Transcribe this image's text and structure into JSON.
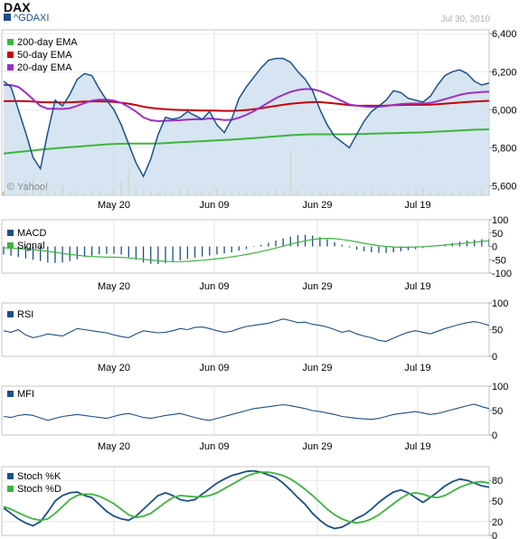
{
  "header": {
    "title": "DAX",
    "symbol": "^GDAXI",
    "date": "Jul 30, 2010"
  },
  "watermark": "© Yahoo!",
  "colors": {
    "price_line": "#1b4f8a",
    "price_fill": "#cfe0ee",
    "ema200": "#3cb53c",
    "ema50": "#c8000a",
    "ema20": "#9b30c8",
    "volume": "#f0a030",
    "indicator": "#1b4f8a",
    "signal": "#3cb53c"
  },
  "chart_data": [
    {
      "type": "line",
      "panel": "price",
      "x_ticks": [
        "May 20",
        "Jun 09",
        "Jun 29",
        "Jul 19"
      ],
      "y_ticks": [
        "6,400",
        "6,200",
        "6,000",
        "5,800",
        "5,600"
      ],
      "ylim": [
        5600,
        6400
      ],
      "series": [
        {
          "name": "^GDAXI",
          "values": [
            6150,
            6120,
            6000,
            5880,
            5750,
            5690,
            5880,
            6050,
            6020,
            6080,
            6160,
            6190,
            6180,
            6110,
            6050,
            6000,
            5920,
            5820,
            5720,
            5650,
            5740,
            5870,
            5960,
            5950,
            5960,
            5990,
            5970,
            5950,
            5990,
            5920,
            5880,
            5950,
            6060,
            6120,
            6170,
            6220,
            6260,
            6270,
            6270,
            6250,
            6200,
            6160,
            6100,
            6000,
            5920,
            5860,
            5830,
            5800,
            5870,
            5940,
            5990,
            6020,
            6050,
            6100,
            6090,
            6060,
            6050,
            6040,
            6070,
            6130,
            6180,
            6200,
            6210,
            6190,
            6150,
            6130,
            6140
          ]
        },
        {
          "name": "200-day EMA",
          "values": [
            5770,
            5774,
            5778,
            5782,
            5786,
            5790,
            5794,
            5797,
            5800,
            5803,
            5806,
            5809,
            5812,
            5815,
            5818,
            5820,
            5821,
            5822,
            5822,
            5822,
            5822,
            5823,
            5825,
            5827,
            5829,
            5831,
            5833,
            5835,
            5837,
            5839,
            5841,
            5843,
            5845,
            5848,
            5851,
            5854,
            5857,
            5860,
            5863,
            5866,
            5868,
            5870,
            5871,
            5871,
            5871,
            5871,
            5871,
            5871,
            5872,
            5873,
            5874,
            5875,
            5876,
            5877,
            5878,
            5879,
            5880,
            5881,
            5883,
            5885,
            5887,
            5889,
            5891,
            5893,
            5895,
            5896,
            5897
          ]
        },
        {
          "name": "50-day EMA",
          "values": [
            6045,
            6046,
            6046,
            6045,
            6043,
            6040,
            6039,
            6039,
            6038,
            6039,
            6041,
            6043,
            6044,
            6044,
            6043,
            6041,
            6037,
            6032,
            6025,
            6016,
            6010,
            6006,
            6003,
            6000,
            5999,
            5998,
            5997,
            5996,
            5996,
            5995,
            5994,
            5994,
            5996,
            5999,
            6003,
            6008,
            6014,
            6020,
            6026,
            6031,
            6035,
            6038,
            6040,
            6040,
            6037,
            6033,
            6029,
            6024,
            6022,
            6021,
            6021,
            6021,
            6022,
            6024,
            6025,
            6026,
            6026,
            6026,
            6027,
            6029,
            6032,
            6035,
            6038,
            6041,
            6043,
            6045,
            6047
          ]
        },
        {
          "name": "20-day EMA",
          "values": [
            6130,
            6130,
            6120,
            6090,
            6055,
            6020,
            6005,
            6005,
            6004,
            6008,
            6020,
            6035,
            6048,
            6053,
            6053,
            6048,
            6036,
            6015,
            5990,
            5960,
            5945,
            5940,
            5942,
            5943,
            5945,
            5948,
            5950,
            5950,
            5954,
            5951,
            5946,
            5947,
            5958,
            5973,
            5992,
            6015,
            6038,
            6060,
            6078,
            6094,
            6104,
            6109,
            6108,
            6098,
            6082,
            6064,
            6046,
            6028,
            6021,
            6017,
            6015,
            6016,
            6019,
            6025,
            6030,
            6032,
            6033,
            6033,
            6036,
            6045,
            6056,
            6067,
            6078,
            6086,
            6090,
            6093,
            6095
          ]
        }
      ],
      "volume_relative": [
        0.05,
        0.03,
        0.02,
        0.2,
        0.22,
        0.1,
        0.06,
        0.05,
        0.12,
        0.05,
        0.06,
        0.03,
        0.05,
        0.05,
        0.04,
        0.1,
        0.18,
        0.35,
        0.1,
        0.06,
        0.05,
        0.04,
        0.06,
        0.04,
        0.08,
        0.1,
        0.06,
        0.07,
        0.05,
        0.1,
        0.06,
        0.05,
        0.06,
        0.05,
        0.07,
        0.06,
        0.05,
        0.1,
        0.05,
        0.6,
        0.08,
        0.04,
        0.06,
        0.07,
        0.05,
        0.06,
        0.04,
        0.08,
        0.05,
        0.06,
        0.07,
        0.05,
        0.06,
        0.04,
        0.05,
        0.06,
        0.07,
        0.1,
        0.05,
        0.06,
        0.05,
        0.04,
        0.05,
        0.06,
        0.05,
        0.09,
        0.07
      ]
    },
    {
      "type": "bar",
      "panel": "macd",
      "x_ticks": [
        "May 20",
        "Jun 09",
        "Jun 29",
        "Jul 19"
      ],
      "y_ticks": [
        "100",
        "50",
        "0",
        "-50",
        "-100"
      ],
      "ylim": [
        -100,
        100
      ],
      "series": [
        {
          "name": "MACD",
          "values": [
            -30,
            -35,
            -40,
            -45,
            -50,
            -55,
            -60,
            -62,
            -60,
            -55,
            -48,
            -40,
            -35,
            -30,
            -28,
            -27,
            -30,
            -40,
            -50,
            -60,
            -65,
            -66,
            -63,
            -58,
            -52,
            -47,
            -42,
            -38,
            -34,
            -30,
            -26,
            -22,
            -16,
            -10,
            -2,
            6,
            14,
            22,
            30,
            37,
            42,
            44,
            41,
            35,
            26,
            16,
            6,
            -4,
            -12,
            -18,
            -22,
            -24,
            -24,
            -22,
            -18,
            -14,
            -10,
            -6,
            -2,
            3,
            8,
            13,
            18,
            22,
            25,
            27,
            28
          ]
        },
        {
          "name": "Signal",
          "values": [
            -5,
            -6,
            -8,
            -10,
            -12,
            -15,
            -18,
            -22,
            -26,
            -30,
            -33,
            -36,
            -38,
            -39,
            -40,
            -40,
            -41,
            -43,
            -45,
            -48,
            -51,
            -54,
            -56,
            -57,
            -57,
            -56,
            -54,
            -52,
            -49,
            -46,
            -43,
            -39,
            -35,
            -30,
            -25,
            -19,
            -13,
            -6,
            1,
            8,
            15,
            21,
            26,
            29,
            30,
            29,
            26,
            22,
            17,
            12,
            7,
            3,
            0,
            -2,
            -3,
            -3,
            -2,
            -1,
            1,
            3,
            5,
            8,
            10,
            13,
            16,
            19,
            21
          ]
        }
      ]
    },
    {
      "type": "line",
      "panel": "rsi",
      "x_ticks": [
        "May 20",
        "Jun 09",
        "Jun 29",
        "Jul 19"
      ],
      "y_ticks": [
        "100",
        "50",
        "0"
      ],
      "ylim": [
        0,
        100
      ],
      "series": [
        {
          "name": "RSI",
          "values": [
            48,
            45,
            50,
            40,
            35,
            38,
            42,
            40,
            38,
            45,
            52,
            50,
            48,
            46,
            44,
            40,
            37,
            35,
            42,
            48,
            46,
            44,
            45,
            48,
            52,
            50,
            54,
            55,
            52,
            48,
            45,
            47,
            52,
            56,
            58,
            60,
            62,
            66,
            70,
            67,
            63,
            64,
            60,
            58,
            55,
            50,
            45,
            48,
            42,
            38,
            35,
            30,
            28,
            34,
            40,
            45,
            48,
            45,
            42,
            47,
            52,
            56,
            60,
            63,
            65,
            62,
            58
          ]
        }
      ]
    },
    {
      "type": "line",
      "panel": "mfi",
      "x_ticks": [
        "May 20",
        "Jun 09",
        "Jun 29",
        "Jul 19"
      ],
      "y_ticks": [
        "100",
        "50",
        "0"
      ],
      "ylim": [
        0,
        100
      ],
      "series": [
        {
          "name": "MFI",
          "values": [
            38,
            36,
            40,
            42,
            40,
            35,
            30,
            34,
            38,
            40,
            42,
            40,
            38,
            36,
            34,
            38,
            42,
            44,
            40,
            36,
            34,
            37,
            40,
            42,
            44,
            40,
            36,
            32,
            30,
            34,
            38,
            42,
            46,
            50,
            54,
            56,
            58,
            60,
            62,
            60,
            57,
            54,
            50,
            48,
            45,
            42,
            38,
            36,
            34,
            33,
            32,
            34,
            38,
            42,
            44,
            46,
            48,
            45,
            42,
            44,
            48,
            52,
            56,
            60,
            63,
            58,
            54
          ]
        }
      ]
    },
    {
      "type": "line",
      "panel": "stochastic",
      "x_ticks": [
        "May 20",
        "Jun 09",
        "Jun 29",
        "Jul 19"
      ],
      "y_ticks": [
        "80",
        "50",
        "20",
        "0"
      ],
      "ylim": [
        0,
        100
      ],
      "series": [
        {
          "name": "Stoch %K",
          "values": [
            40,
            32,
            24,
            18,
            14,
            20,
            34,
            50,
            58,
            62,
            63,
            58,
            55,
            45,
            35,
            28,
            24,
            22,
            28,
            38,
            48,
            58,
            62,
            58,
            52,
            50,
            52,
            60,
            68,
            76,
            82,
            87,
            90,
            93,
            94,
            92,
            88,
            84,
            76,
            66,
            55,
            45,
            32,
            22,
            14,
            10,
            12,
            18,
            25,
            30,
            38,
            48,
            56,
            63,
            66,
            62,
            55,
            48,
            55,
            63,
            72,
            78,
            82,
            80,
            76,
            72,
            70
          ]
        },
        {
          "name": "Stoch %D",
          "values": [
            42,
            38,
            33,
            28,
            24,
            22,
            24,
            32,
            42,
            52,
            58,
            60,
            60,
            57,
            52,
            46,
            38,
            30,
            26,
            28,
            32,
            40,
            48,
            55,
            58,
            57,
            56,
            56,
            58,
            62,
            68,
            74,
            80,
            86,
            90,
            92,
            92,
            90,
            87,
            82,
            75,
            67,
            58,
            48,
            38,
            30,
            24,
            20,
            18,
            20,
            24,
            30,
            38,
            46,
            54,
            60,
            62,
            60,
            56,
            55,
            58,
            64,
            70,
            74,
            77,
            78,
            76
          ]
        }
      ]
    }
  ]
}
